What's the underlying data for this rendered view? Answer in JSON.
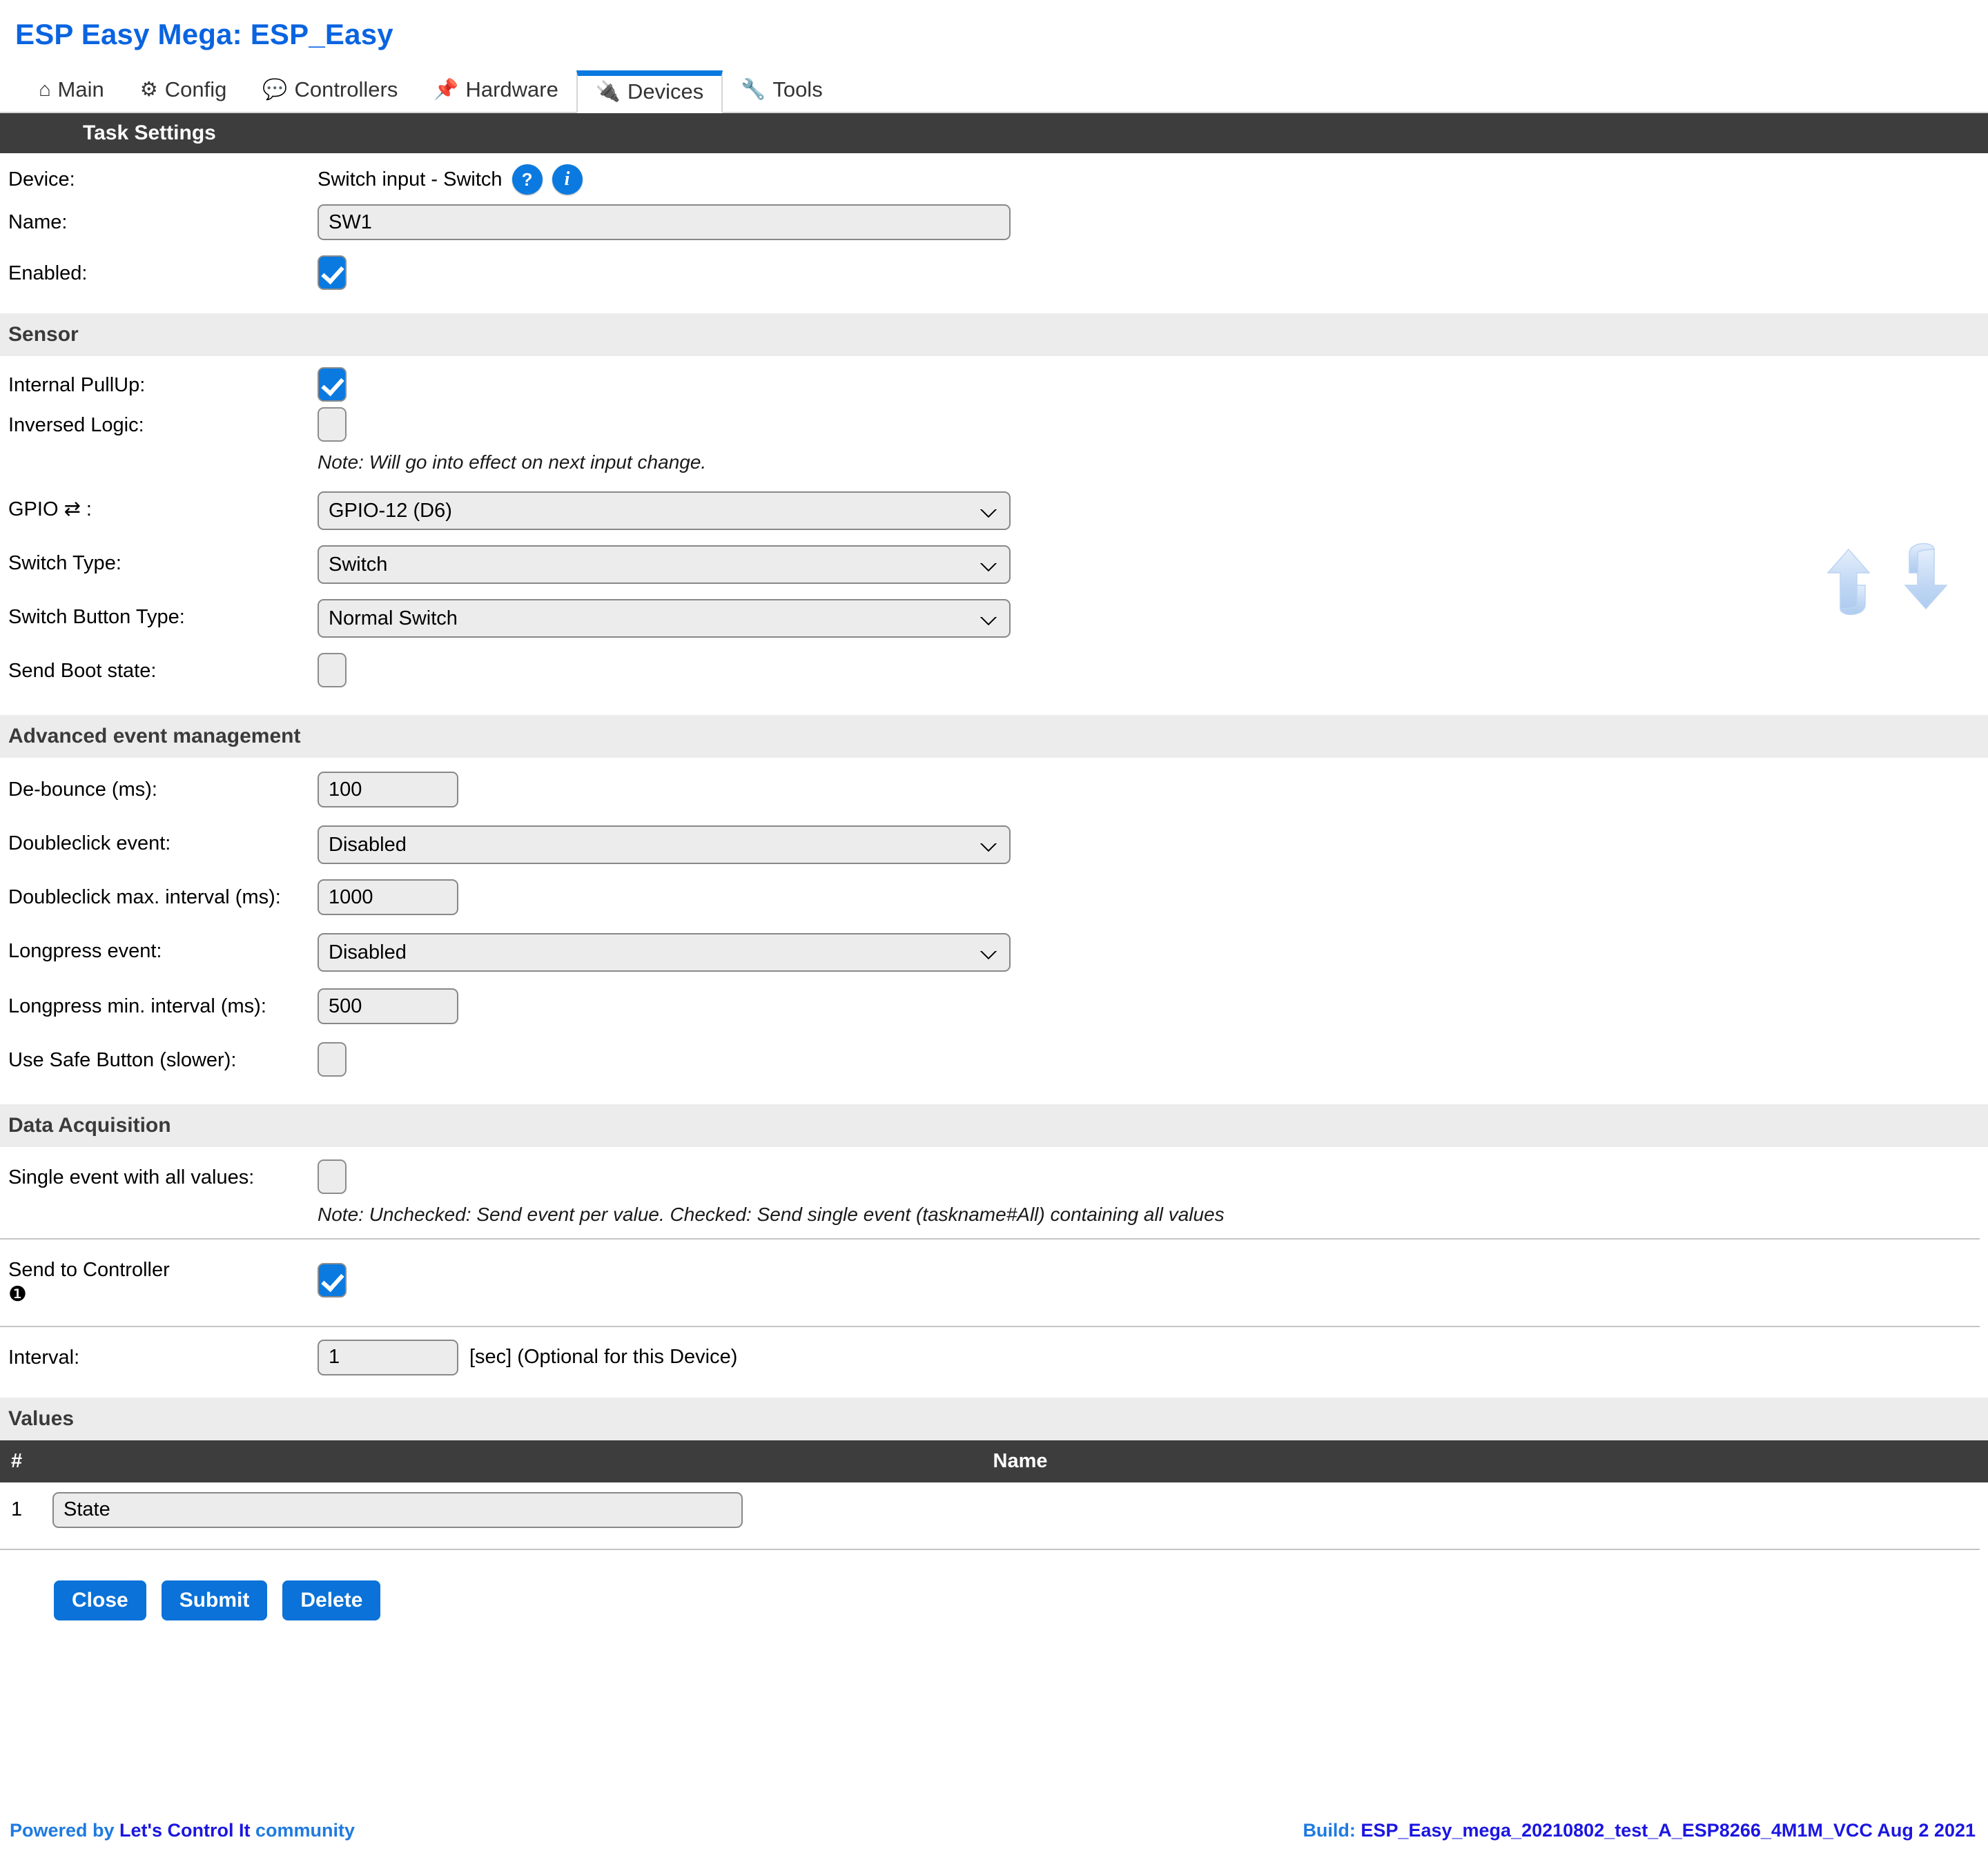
{
  "header": {
    "title": "ESP Easy Mega: ESP_Easy"
  },
  "tabs": [
    {
      "label": "Main",
      "icon": "home-icon",
      "glyph": "⌂",
      "active": false
    },
    {
      "label": "Config",
      "icon": "gear-icon",
      "glyph": "⚙",
      "active": false
    },
    {
      "label": "Controllers",
      "icon": "speech-bubble-icon",
      "glyph": "💬",
      "active": false
    },
    {
      "label": "Hardware",
      "icon": "pushpin-icon",
      "glyph": "📌",
      "active": false
    },
    {
      "label": "Devices",
      "icon": "plug-icon",
      "glyph": "🔌",
      "active": true
    },
    {
      "label": "Tools",
      "icon": "wrench-icon",
      "glyph": "🔧",
      "active": false
    }
  ],
  "sections": {
    "task_settings": "Task Settings",
    "sensor": "Sensor",
    "advanced": "Advanced event management",
    "data_acquisition": "Data Acquisition",
    "values": "Values"
  },
  "device": {
    "label": "Device:",
    "value": "Switch input - Switch",
    "help_badge": "?",
    "info_badge": "i"
  },
  "name": {
    "label": "Name:",
    "value": "SW1"
  },
  "enabled": {
    "label": "Enabled:",
    "checked": true
  },
  "sensor": {
    "internal_pullup": {
      "label": "Internal PullUp:",
      "checked": true
    },
    "inversed_logic": {
      "label": "Inversed Logic:",
      "checked": false
    },
    "inversed_note": "Note: Will go into effect on next input change.",
    "gpio": {
      "label": "GPIO ⇄ :",
      "value": "GPIO-12 (D6)"
    },
    "switch_type": {
      "label": "Switch Type:",
      "value": "Switch"
    },
    "switch_button_type": {
      "label": "Switch Button Type:",
      "value": "Normal Switch"
    },
    "send_boot_state": {
      "label": "Send Boot state:",
      "checked": false
    }
  },
  "advanced": {
    "debounce": {
      "label": "De-bounce (ms):",
      "value": "100"
    },
    "doubleclick_event": {
      "label": "Doubleclick event:",
      "value": "Disabled"
    },
    "doubleclick_interval": {
      "label": "Doubleclick max. interval (ms):",
      "value": "1000"
    },
    "longpress_event": {
      "label": "Longpress event:",
      "value": "Disabled"
    },
    "longpress_interval": {
      "label": "Longpress min. interval (ms):",
      "value": "500"
    },
    "safe_button": {
      "label": "Use Safe Button (slower):",
      "checked": false
    }
  },
  "data_acquisition": {
    "single_event": {
      "label": "Single event with all values:",
      "checked": false
    },
    "single_event_note": "Note: Unchecked: Send event per value. Checked: Send single event (taskname#All) containing all values",
    "send_to_controller": {
      "label": "Send to Controller",
      "marker": "❶",
      "checked": true
    },
    "interval": {
      "label": "Interval:",
      "value": "1",
      "suffix": "[sec] (Optional for this Device)"
    }
  },
  "values_table": {
    "columns": [
      "#",
      "Name"
    ],
    "rows": [
      {
        "index": "1",
        "name": "State"
      }
    ]
  },
  "buttons": {
    "close": "Close",
    "submit": "Submit",
    "delete": "Delete"
  },
  "footer": {
    "powered_prefix": "Powered by ",
    "powered_link": "Let's Control It",
    "powered_suffix": " community",
    "build_label": "Build: ",
    "build_value": "ESP_Easy_mega_20210802_test_A_ESP8266_4M1M_VCC Aug 2 2021"
  },
  "colors": {
    "accent": "#0a7ae0",
    "dark_bar": "#3d3d3d",
    "grey_bar": "#ececec",
    "link": "#1b16e0"
  }
}
